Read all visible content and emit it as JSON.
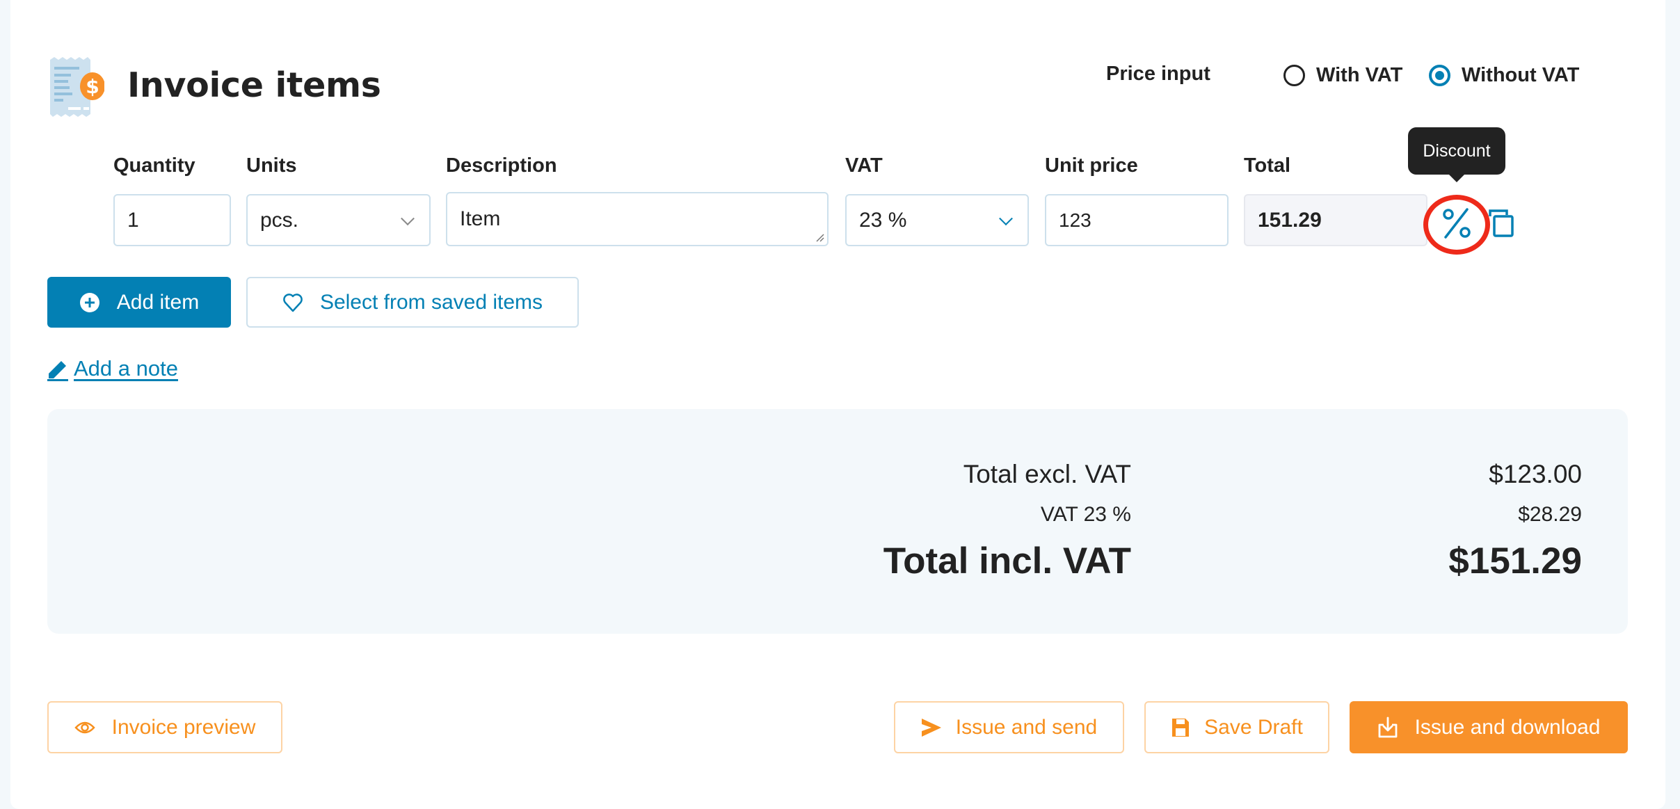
{
  "header": {
    "title": "Invoice items",
    "title_icon": "receipt-dollar-icon"
  },
  "price_input": {
    "label": "Price input",
    "options": [
      {
        "label": "With VAT",
        "selected": false
      },
      {
        "label": "Without VAT",
        "selected": true
      }
    ]
  },
  "columns": {
    "quantity": "Quantity",
    "units": "Units",
    "description": "Description",
    "vat": "VAT",
    "unit_price": "Unit price",
    "total": "Total"
  },
  "item": {
    "quantity": "1",
    "units": "pcs.",
    "description": "Item",
    "vat": "23 %",
    "unit_price": "123",
    "total": "151.29"
  },
  "row_actions": {
    "discount_icon": "percent-icon",
    "duplicate_icon": "copy-icon",
    "tooltip": "Discount"
  },
  "actions": {
    "add_item": "Add item",
    "select_saved": "Select from saved items",
    "add_note": "Add a note"
  },
  "summary": {
    "rows": [
      {
        "label": "Total excl. VAT",
        "value": "$123.00"
      },
      {
        "label": "VAT 23 %",
        "value": "$28.29"
      },
      {
        "label": "Total incl. VAT",
        "value": "$151.29"
      }
    ]
  },
  "footer": {
    "invoice_preview": "Invoice preview",
    "issue_and_send": "Issue and send",
    "save_draft": "Save Draft",
    "issue_and_download": "Issue and download"
  },
  "colors": {
    "primary_blue": "#0380b4",
    "accent_orange": "#f8912a",
    "highlight_red": "#ee2a1a",
    "page_bg": "#f3f8fb"
  }
}
